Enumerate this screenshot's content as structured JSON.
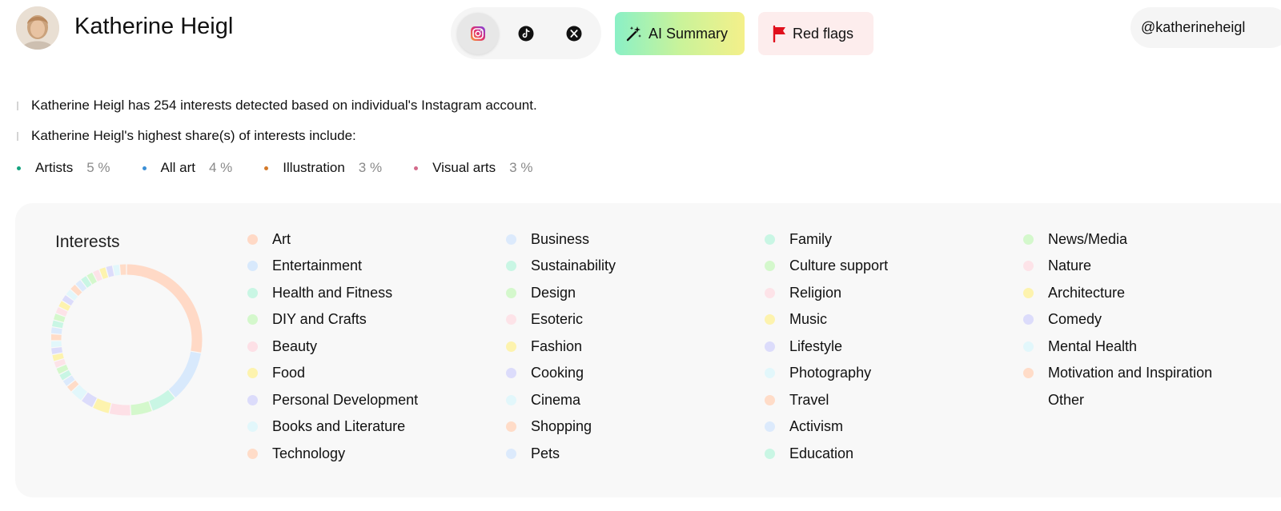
{
  "profile": {
    "name": "Katherine Heigl",
    "handle": "@katherineheigl"
  },
  "social": [
    {
      "id": "instagram",
      "icon": "instagram-icon",
      "active": true
    },
    {
      "id": "tiktok",
      "icon": "tiktok-icon",
      "active": false
    },
    {
      "id": "x",
      "icon": "x-icon",
      "active": false
    }
  ],
  "actions": {
    "ai_summary": "AI Summary",
    "red_flags": "Red flags"
  },
  "summary": {
    "line1": "Katherine Heigl has 254 interests detected based on individual's Instagram account.",
    "line2": "Katherine Heigl's highest share(s) of interests include:"
  },
  "top_interests": [
    {
      "label": "Artists",
      "pct": "5 %",
      "color": "#14a37f"
    },
    {
      "label": "All art",
      "pct": "4 %",
      "color": "#3b8fd6"
    },
    {
      "label": "Illustration",
      "pct": "3 %",
      "color": "#d47a2a"
    },
    {
      "label": "Visual arts",
      "pct": "3 %",
      "color": "#d36a8a"
    }
  ],
  "interests_panel": {
    "title": "Interests",
    "columns": [
      [
        {
          "label": "Art",
          "color": "#ffd9c6"
        },
        {
          "label": "Entertainment",
          "color": "#d8e9fc"
        },
        {
          "label": "Health and Fitness",
          "color": "#c9f6e4"
        },
        {
          "label": "DIY and Crafts",
          "color": "#d4f8cc"
        },
        {
          "label": "Beauty",
          "color": "#fde0e6"
        },
        {
          "label": "Food",
          "color": "#fdf3ae"
        },
        {
          "label": "Personal Development",
          "color": "#dcdcfb"
        },
        {
          "label": "Books and Literature",
          "color": "#e2f7fb"
        },
        {
          "label": "Technology",
          "color": "#ffdcc8"
        }
      ],
      [
        {
          "label": "Business",
          "color": "#dceafc"
        },
        {
          "label": "Sustainability",
          "color": "#c9f6e4"
        },
        {
          "label": "Design",
          "color": "#d4f8cc"
        },
        {
          "label": "Esoteric",
          "color": "#fde3e8"
        },
        {
          "label": "Fashion",
          "color": "#fdf3ae"
        },
        {
          "label": "Cooking",
          "color": "#dcdcfb"
        },
        {
          "label": "Cinema",
          "color": "#e2f7fb"
        },
        {
          "label": "Shopping",
          "color": "#ffdcc8"
        },
        {
          "label": "Pets",
          "color": "#dceafc"
        }
      ],
      [
        {
          "label": "Family",
          "color": "#c9f6e4"
        },
        {
          "label": "Culture support",
          "color": "#d4f8cc"
        },
        {
          "label": "Religion",
          "color": "#fde3e8"
        },
        {
          "label": "Music",
          "color": "#fdf3ae"
        },
        {
          "label": "Lifestyle",
          "color": "#dcdcfb"
        },
        {
          "label": "Photography",
          "color": "#e2f7fb"
        },
        {
          "label": "Travel",
          "color": "#ffdcc8"
        },
        {
          "label": "Activism",
          "color": "#dceafc"
        },
        {
          "label": "Education",
          "color": "#c9f6e4"
        }
      ],
      [
        {
          "label": "News/Media",
          "color": "#d4f8cc"
        },
        {
          "label": "Nature",
          "color": "#fde3e8"
        },
        {
          "label": "Architecture",
          "color": "#fdf3ae"
        },
        {
          "label": "Comedy",
          "color": "#dcdcfb"
        },
        {
          "label": "Mental Health",
          "color": "#e2f7fb"
        },
        {
          "label": "Motivation and Inspiration",
          "color": "#ffdcc8"
        },
        {
          "label": "Other",
          "color": ""
        }
      ]
    ]
  }
}
